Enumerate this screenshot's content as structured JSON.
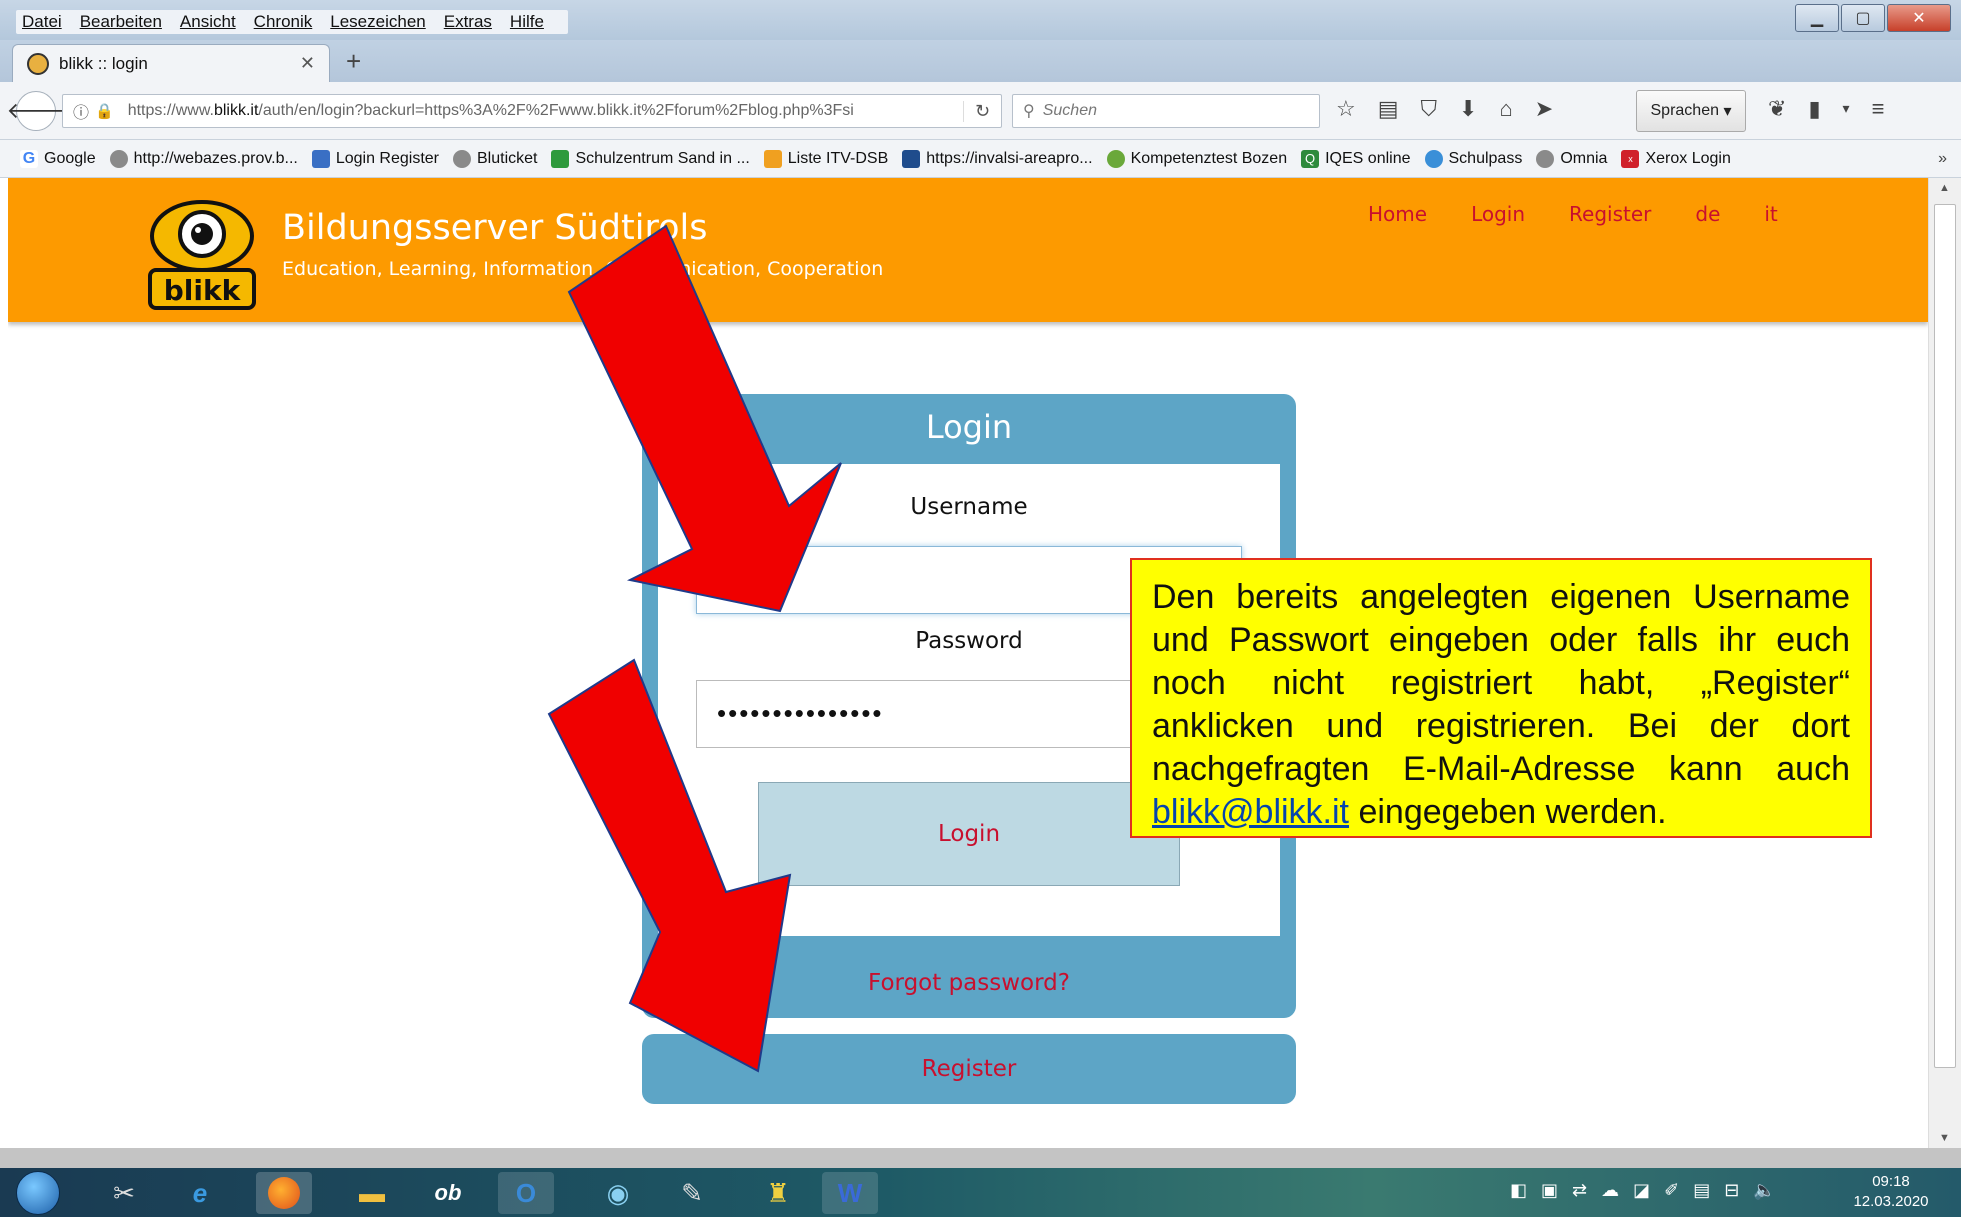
{
  "browser": {
    "menu": [
      "Datei",
      "Bearbeiten",
      "Ansicht",
      "Chronik",
      "Lesezeichen",
      "Extras",
      "Hilfe"
    ],
    "tab_title": "blikk :: login",
    "url_prefix": "https://www.",
    "url_domain": "blikk.it",
    "url_rest": "/auth/en/login?backurl=https%3A%2F%2Fwww.blikk.it%2Fforum%2Fblog.php%3Fsi",
    "search_placeholder": "Suchen",
    "sprachen_label": "Sprachen",
    "bookmarks": [
      {
        "label": "Google",
        "color": "#4285f4",
        "glyph": "G"
      },
      {
        "label": "http://webazes.prov.b...",
        "color": "#8a8a8a",
        "glyph": "◐"
      },
      {
        "label": "Login Register",
        "color": "#3a6fc4",
        "glyph": "▮"
      },
      {
        "label": "Bluticket",
        "color": "#8a8a8a",
        "glyph": "◐"
      },
      {
        "label": "Schulzentrum Sand in ...",
        "color": "#2e9a3c",
        "glyph": "▮"
      },
      {
        "label": "Liste ITV-DSB",
        "color": "#f0a020",
        "glyph": "▣"
      },
      {
        "label": "https://invalsi-areapro...",
        "color": "#1f4c8c",
        "glyph": "▮"
      },
      {
        "label": "Kompetenztest Bozen",
        "color": "#6aa83a",
        "glyph": "◑"
      },
      {
        "label": "IQES online",
        "color": "#2e8a3c",
        "glyph": "Q"
      },
      {
        "label": "Schulpass",
        "color": "#3a8fd8",
        "glyph": "✿"
      },
      {
        "label": "Omnia",
        "color": "#8a8a8a",
        "glyph": "◐"
      },
      {
        "label": "Xerox Login",
        "color": "#d0202a",
        "glyph": "x"
      }
    ]
  },
  "site": {
    "title": "Bildungsserver Südtirols",
    "subtitle": "Education, Learning, Information, Communication, Cooperation",
    "logo_text": "blikk",
    "nav": [
      "Home",
      "Login",
      "Register",
      "de",
      "it"
    ]
  },
  "login": {
    "title": "Login",
    "username_label": "Username",
    "username_value": "",
    "password_label": "Password",
    "password_value": "•••••••••••••••",
    "button_label": "Login",
    "forgot_label": "Forgot password?",
    "register_label": "Register"
  },
  "note": {
    "text_before": "Den bereits angelegten eigenen Username und Passwort eingeben oder falls ihr euch noch nicht registriert habt, „Register“ anklicken und registrieren. Bei der dort nachgefragten E-Mail-Adresse kann auch ",
    "link": "blikk@blikk.it",
    "text_after": " eingegeben werden."
  },
  "taskbar": {
    "time": "09:18",
    "date": "12.03.2020"
  }
}
